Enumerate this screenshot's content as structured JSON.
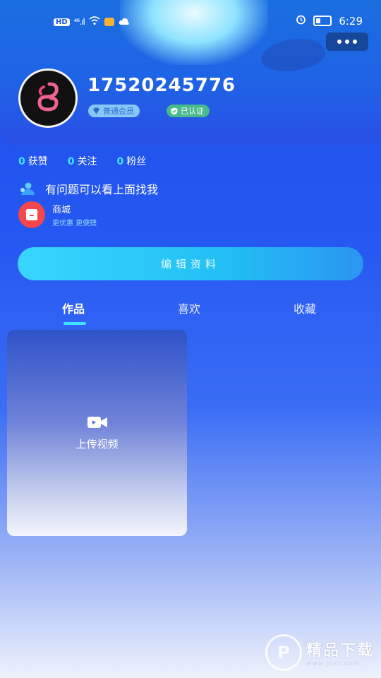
{
  "status_bar": {
    "network_badge": "HD",
    "signal": "⁴⁶.ıl",
    "time": "6:29"
  },
  "profile": {
    "username": "17520245776",
    "member_badge": "普通会员",
    "verified_badge": "已认证"
  },
  "stats": [
    {
      "count": "0",
      "label": "获赞"
    },
    {
      "count": "0",
      "label": "关注"
    },
    {
      "count": "0",
      "label": "粉丝"
    }
  ],
  "help_text": "有问题可以看上面找我",
  "shop": {
    "title": "商城",
    "subtitle": "更优惠 更便捷"
  },
  "edit_button_label": "编辑资料",
  "tabs": [
    {
      "label": "作品"
    },
    {
      "label": "喜欢"
    },
    {
      "label": "收藏"
    }
  ],
  "upload_card": {
    "label": "上传视频"
  },
  "watermark": {
    "text": "精品下载",
    "url": "www.jpxz.com"
  },
  "colors": {
    "accent": "#3fe3ff",
    "button": "#22bff4",
    "shop_icon": "#f3474c"
  }
}
